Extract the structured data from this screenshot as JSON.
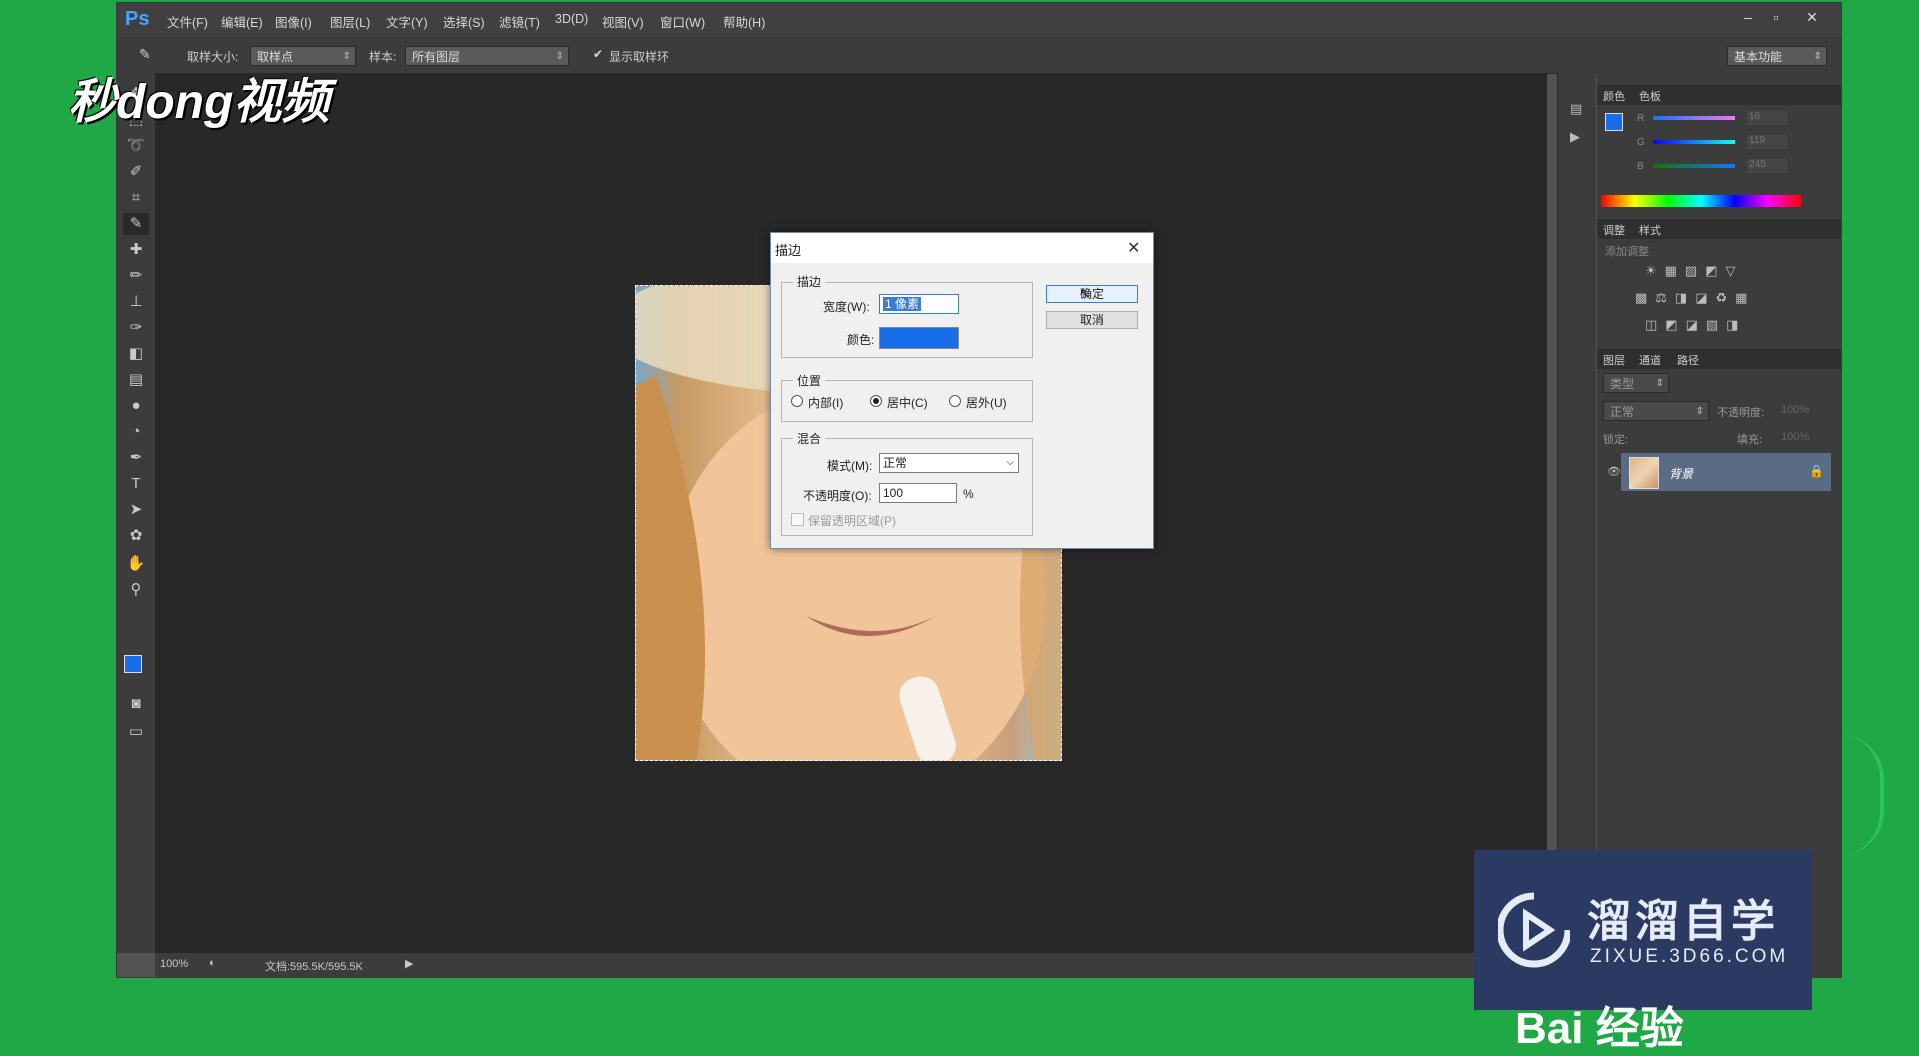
{
  "watermark_top": "秒dong视频",
  "watermark_brand": {
    "name": "溜溜自学",
    "url": "ZIXUE.3D66.COM"
  },
  "watermark_bottom": "Bai 经验",
  "menu": {
    "logo": "Ps",
    "items": [
      "文件(F)",
      "编辑(E)",
      "图像(I)",
      "图层(L)",
      "文字(Y)",
      "选择(S)",
      "滤镜(T)",
      "3D(D)",
      "视图(V)",
      "窗口(W)",
      "帮助(H)"
    ]
  },
  "options": {
    "sample_size_label": "取样大小:",
    "sample_size_value": "取样点",
    "sample_label": "样本:",
    "sample_value": "所有图层",
    "show_ring_label": "显示取样环",
    "workspace": "基本功能"
  },
  "status": {
    "zoom": "100%",
    "doc": "文档:595.5K/595.5K"
  },
  "panels": {
    "color_tabs": [
      "颜色",
      "色板"
    ],
    "rgb": [
      {
        "label": "R",
        "value": "16"
      },
      {
        "label": "G",
        "value": "119"
      },
      {
        "label": "B",
        "value": "245"
      }
    ],
    "adjust_tabs": [
      "调整",
      "样式"
    ],
    "adjust_title": "添加调整",
    "layers_tabs": [
      "图层",
      "通道",
      "路径"
    ],
    "layers_filter": "类型",
    "blend_mode": "正常",
    "opacity_label": "不透明度:",
    "opacity_value": "100%",
    "lock_label": "锁定:",
    "fill_label": "填充:",
    "fill_value": "100%",
    "layer_name": "背景"
  },
  "dialog": {
    "title": "描边",
    "stroke_group": "描边",
    "width_label": "宽度(W):",
    "width_value": "1 像素",
    "color_label": "颜色:",
    "stroke_color": "#1a6de8",
    "ok": "确定",
    "cancel": "取消",
    "position_group": "位置",
    "positions": [
      "内部(I)",
      "居中(C)",
      "居外(U)"
    ],
    "selected_position": "居中(C)",
    "blend_group": "混合",
    "mode_label": "模式(M):",
    "mode_value": "正常",
    "opacity_label": "不透明度(O):",
    "opacity_value": "100",
    "percent": "%",
    "preserve_label": "保留透明区域(P)"
  }
}
